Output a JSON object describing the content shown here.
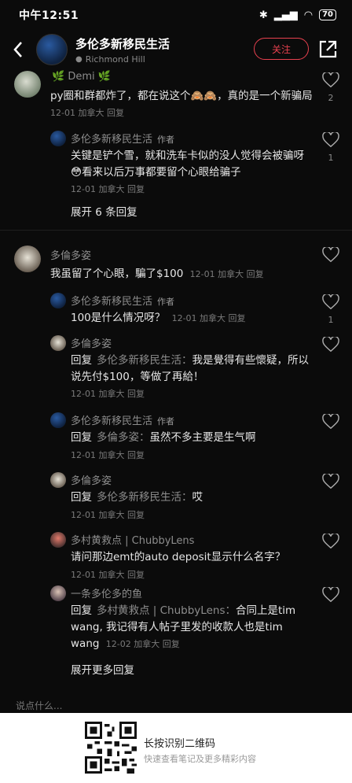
{
  "status_bar": {
    "time": "中午12:51",
    "signal": "4G",
    "battery": "70"
  },
  "header": {
    "title": "多伦多新移民生活",
    "location": "Richmond Hill",
    "follow_label": "关注"
  },
  "comments": [
    {
      "name": "Demi",
      "text": "py圈和群都炸了，都在说这个🙈🙈，真的是一个新骗局",
      "meta": "12-01 加拿大 回复",
      "likes": "2"
    },
    {
      "name": "多伦多新移民生活",
      "tag": "作者",
      "text": "关键是铲个雪，就和洗车卡似的没人觉得会被骗呀😳看来以后万事都要留个心眼给骗子",
      "meta": "12-01 加拿大 回复",
      "likes": "1"
    },
    {
      "expand": "展开 6 条回复"
    },
    {
      "name": "多倫多姿",
      "text": "我虽留了个心眼，騙了$100",
      "meta": "12-01 加拿大 回复"
    },
    {
      "name": "多伦多新移民生活",
      "tag": "作者",
      "text": "100是什么情况呀？",
      "meta": "12-01 加拿大 回复",
      "likes": "1"
    },
    {
      "name": "多倫多姿",
      "reply_word": "回复",
      "reply_to": "多伦多新移民生活：",
      "text": "我是覺得有些懷疑，所以说先付$100，等做了再給！",
      "meta": "12-01 加拿大 回复"
    },
    {
      "name": "多伦多新移民生活",
      "tag": "作者",
      "reply_word": "回复",
      "reply_to": "多倫多姿：",
      "text": "虽然不多主要是生气啊",
      "meta": "12-01 加拿大 回复"
    },
    {
      "name": "多倫多姿",
      "reply_word": "回复",
      "reply_to": "多伦多新移民生活：",
      "text": "哎",
      "meta": "12-01 加拿大 回复"
    },
    {
      "name": "多村黄救点 | ChubbyLens",
      "text": "请问那边emt的auto deposit显示什么名字？",
      "meta": "12-01 加拿大 回复"
    },
    {
      "name": "一条多伦多的鱼",
      "reply_word": "回复",
      "reply_to": "多村黄救点 | ChubbyLens：",
      "text": "合同上是tim wang, 我记得有人帖子里发的收款人也是tim wang",
      "meta": "12-02 加拿大 回复"
    },
    {
      "expand": "展开更多回复"
    }
  ],
  "bottom": {
    "input_placeholder": "说点什么...",
    "qr_title": "长按识别二维码",
    "qr_subtitle": "快速查看笔记及更多精彩内容"
  },
  "colors": {
    "accent": "#e8414f",
    "background": "#0b0b0b"
  }
}
